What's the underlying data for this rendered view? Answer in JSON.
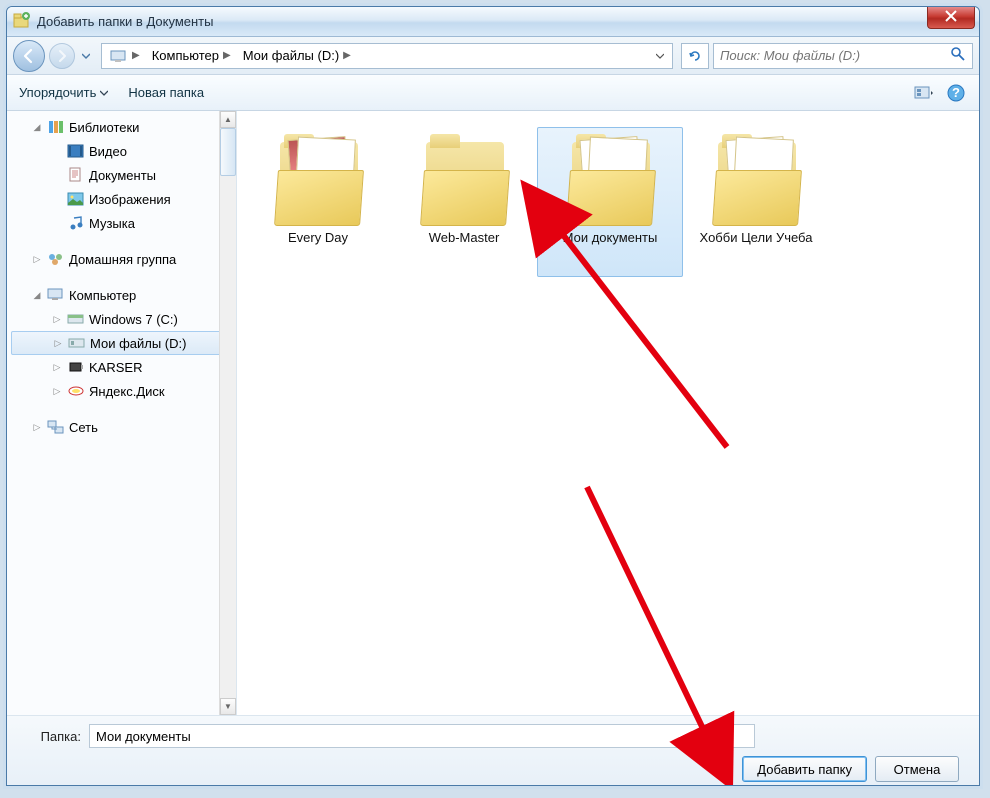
{
  "window": {
    "title": "Добавить папки в Документы"
  },
  "nav": {
    "breadcrumbs": [
      "Компьютер",
      "Мои файлы (D:)"
    ],
    "search_placeholder": "Поиск: Мои файлы (D:)"
  },
  "toolbar": {
    "organize": "Упорядочить",
    "new_folder": "Новая папка"
  },
  "sidebar": {
    "libraries": "Библиотеки",
    "video": "Видео",
    "documents": "Документы",
    "images": "Изображения",
    "music": "Музыка",
    "homegroup": "Домашняя группа",
    "computer": "Компьютер",
    "drive_c": "Windows 7 (C:)",
    "drive_d": "Мои файлы (D:)",
    "karser": "KARSER",
    "yadisk": "Яндекс.Диск",
    "network": "Сеть"
  },
  "folders": [
    {
      "label": "Every Day"
    },
    {
      "label": "Web-Master"
    },
    {
      "label": "Мои документы"
    },
    {
      "label": "Хобби Цели Учеба"
    }
  ],
  "footer": {
    "folder_label": "Папка:",
    "folder_value": "Мои документы",
    "add_button": "Добавить папку",
    "cancel_button": "Отмена"
  }
}
